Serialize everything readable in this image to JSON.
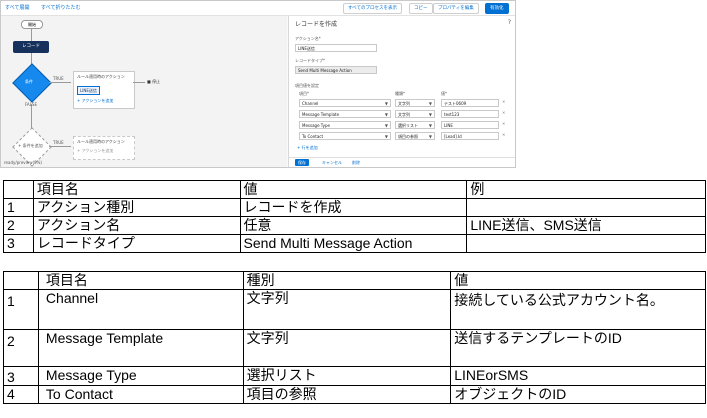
{
  "screenshot": {
    "toolbar": {
      "show_all": "すべて展開",
      "collapse_all": "すべて折りたたむ",
      "show_processes": "すべてのプロセスを表示",
      "copy": "コピー",
      "edit_properties": "プロパティを編集",
      "activate": "有効化"
    },
    "canvas": {
      "start_label": "開始",
      "record_node": "レコード",
      "decision1": "条件",
      "true_label": "TRUE",
      "false_label": "FALSE",
      "loop_title": "ルール適用時のアクション",
      "action_chip": "LINE送信",
      "add_action": "+ アクションを追加",
      "stop_label": "停止",
      "decision2": "+ 条件を追加",
      "loop_title2": "ルール適用時のアクション",
      "add_action2": "+ アクションを追加",
      "status": "ready/preview(0%)"
    },
    "panel": {
      "title": "レコードを作成",
      "action_name_label": "アクション名*",
      "action_name_value": "LINE送信",
      "record_type_label": "レコードタイプ*",
      "record_type_value": "Send Multi Message Action",
      "fields_label": "項目値を設定",
      "col_field": "項目*",
      "col_type": "種類*",
      "col_value": "値*",
      "rows": [
        {
          "field": "Channel",
          "type": "文字列",
          "value": "テスト0609"
        },
        {
          "field": "Message Template",
          "type": "文字列",
          "value": "test123"
        },
        {
          "field": "Message Type",
          "type": "選択リスト",
          "value": "LINE"
        },
        {
          "field": "To Contact",
          "type": "項目の参照",
          "value": "[Lead].Id"
        }
      ],
      "add_row": "+ 行を追加",
      "save": "保存",
      "cancel": "キャンセル",
      "delete": "削除"
    }
  },
  "table1": {
    "headers": [
      "",
      "項目名",
      "値",
      "例"
    ],
    "rows": [
      [
        "1",
        "アクション種別",
        "レコードを作成",
        ""
      ],
      [
        "2",
        "アクション名",
        "任意",
        "LINE送信、SMS送信"
      ],
      [
        "3",
        "レコードタイプ",
        "Send Multi Message Action",
        ""
      ]
    ]
  },
  "table2": {
    "headers": [
      "",
      "項目名",
      "種別",
      "値"
    ],
    "rows": [
      [
        "1",
        "Channel",
        "文字列",
        "接続している公式アカウント名。"
      ],
      [
        "2",
        "Message Template",
        "文字列",
        "送信するテンプレートのID"
      ],
      [
        "3",
        "Message Type",
        "選択リスト",
        "LINEorSMS"
      ],
      [
        "4",
        "To Contact",
        "項目の参照",
        "オブジェクトのID"
      ]
    ]
  },
  "colors": {
    "accent": "#0070d2",
    "node_dark": "#16325c",
    "decision": "#1589ee"
  }
}
